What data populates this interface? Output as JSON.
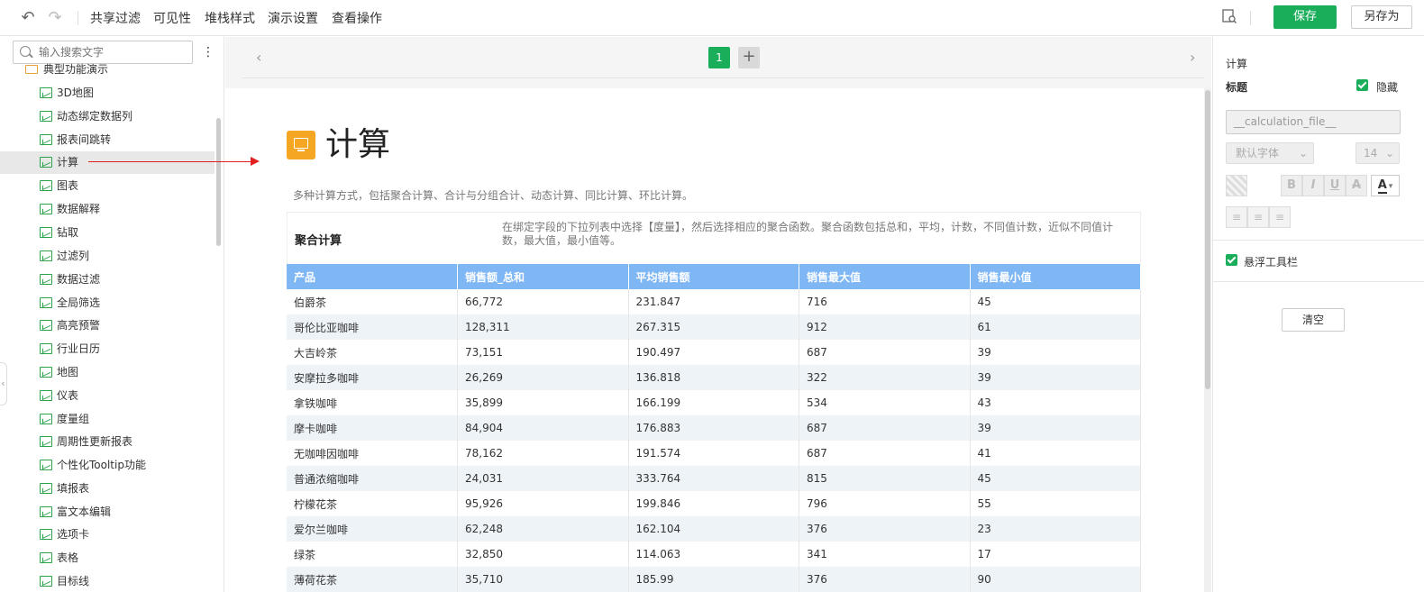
{
  "toolbar": {
    "menus": [
      "共享过滤",
      "可见性",
      "堆栈样式",
      "演示设置",
      "查看操作"
    ],
    "save_label": "保存",
    "save_as_label": "另存为"
  },
  "sidebar": {
    "search_placeholder": "输入搜索文字",
    "folder_label": "典型功能演示",
    "items": [
      {
        "label": "3D地图"
      },
      {
        "label": "动态绑定数据列"
      },
      {
        "label": "报表间跳转"
      },
      {
        "label": "计算",
        "active": true
      },
      {
        "label": "图表"
      },
      {
        "label": "数据解释"
      },
      {
        "label": "钻取"
      },
      {
        "label": "过滤列"
      },
      {
        "label": "数据过滤"
      },
      {
        "label": "全局筛选"
      },
      {
        "label": "高亮预警"
      },
      {
        "label": "行业日历"
      },
      {
        "label": "地图"
      },
      {
        "label": "仪表"
      },
      {
        "label": "度量组"
      },
      {
        "label": "周期性更新报表"
      },
      {
        "label": "个性化Tooltip功能"
      },
      {
        "label": "填报表"
      },
      {
        "label": "富文本编辑"
      },
      {
        "label": "选项卡"
      },
      {
        "label": "表格"
      },
      {
        "label": "目标线"
      }
    ]
  },
  "pagebar": {
    "current_page": "1",
    "add": "+"
  },
  "report": {
    "title": "计算",
    "description": "多种计算方式，包括聚合计算、合计与分组合计、动态计算、同比计算、环比计算。",
    "section_title": "聚合计算",
    "section_desc": "在绑定字段的下拉列表中选择【度量】，然后选择相应的聚合函数。聚合函数包括总和，平均，计数，不同值计数，近似不同值计数，最大值，最小值等。",
    "columns": [
      "产品",
      "销售额_总和",
      "平均销售额",
      "销售最大值",
      "销售最小值"
    ],
    "rows": [
      [
        "伯爵茶",
        "66,772",
        "231.847",
        "716",
        "45"
      ],
      [
        "哥伦比亚咖啡",
        "128,311",
        "267.315",
        "912",
        "61"
      ],
      [
        "大吉岭茶",
        "73,151",
        "190.497",
        "687",
        "39"
      ],
      [
        "安摩拉多咖啡",
        "26,269",
        "136.818",
        "322",
        "39"
      ],
      [
        "拿铁咖啡",
        "35,899",
        "166.199",
        "534",
        "43"
      ],
      [
        "摩卡咖啡",
        "84,904",
        "176.883",
        "687",
        "39"
      ],
      [
        "无咖啡因咖啡",
        "78,162",
        "191.574",
        "687",
        "41"
      ],
      [
        "普通浓缩咖啡",
        "24,031",
        "333.764",
        "815",
        "45"
      ],
      [
        "柠檬花茶",
        "95,926",
        "199.846",
        "796",
        "55"
      ],
      [
        "爱尔兰咖啡",
        "62,248",
        "162.104",
        "376",
        "23"
      ],
      [
        "绿茶",
        "32,850",
        "114.063",
        "341",
        "17"
      ],
      [
        "薄荷花茶",
        "35,710",
        "185.99",
        "376",
        "90"
      ]
    ]
  },
  "right_panel": {
    "heading": "计算",
    "title_label": "标题",
    "hide_label": "隐藏",
    "title_field_value": "__calculation_file__",
    "font_family": "默认字体",
    "font_size": "14",
    "bold": "B",
    "italic": "I",
    "underline": "U",
    "strike": "A",
    "color_a": "A",
    "float_toolbar_label": "悬浮工具栏",
    "clear_label": "清空"
  }
}
